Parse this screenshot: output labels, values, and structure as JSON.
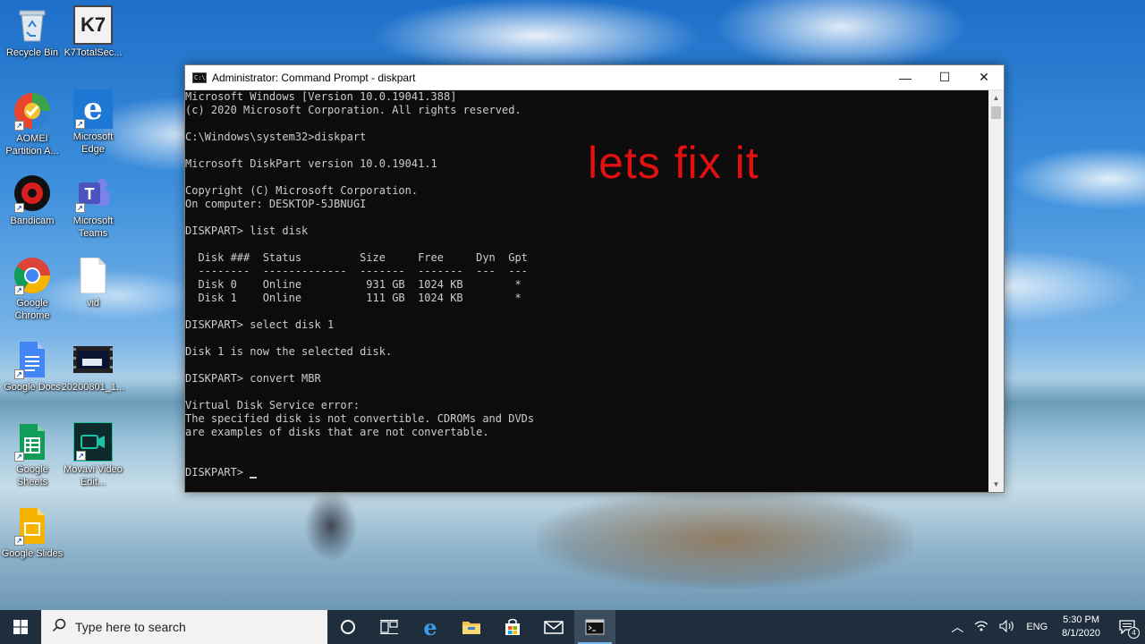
{
  "desktop": {
    "icons": [
      {
        "label": "Recycle Bin",
        "icon": "recycle-bin-icon"
      },
      {
        "label": "K7TotalSec...",
        "icon": "k7-icon",
        "glyph": "K7"
      },
      {
        "label": "AOMEI Partition A...",
        "icon": "aomei-icon"
      },
      {
        "label": "Microsoft Edge",
        "icon": "edge-icon"
      },
      {
        "label": "Bandicam",
        "icon": "bandicam-icon"
      },
      {
        "label": "Microsoft Teams",
        "icon": "teams-icon",
        "glyph": "T"
      },
      {
        "label": "Google Chrome",
        "icon": "chrome-icon"
      },
      {
        "label": "vid",
        "icon": "file-icon"
      },
      {
        "label": "Google Docs",
        "icon": "google-docs-icon"
      },
      {
        "label": "20200801_1...",
        "icon": "video-file-icon"
      },
      {
        "label": "Google Sheets",
        "icon": "google-sheets-icon"
      },
      {
        "label": "Movavi Video Edit...",
        "icon": "movavi-icon"
      },
      {
        "label": "Google Slides",
        "icon": "google-slides-icon"
      }
    ]
  },
  "window": {
    "title": "Administrator: Command Prompt - diskpart",
    "app_icon": "C:\\",
    "buttons": {
      "minimize": "—",
      "maximize": "☐",
      "close": "✕"
    },
    "console_lines": [
      "Microsoft Windows [Version 10.0.19041.388]",
      "(c) 2020 Microsoft Corporation. All rights reserved.",
      "",
      "C:\\Windows\\system32>diskpart",
      "",
      "Microsoft DiskPart version 10.0.19041.1",
      "",
      "Copyright (C) Microsoft Corporation.",
      "On computer: DESKTOP-5JBNUGI",
      "",
      "DISKPART> list disk",
      "",
      "  Disk ###  Status         Size     Free     Dyn  Gpt",
      "  --------  -------------  -------  -------  ---  ---",
      "  Disk 0    Online          931 GB  1024 KB        *",
      "  Disk 1    Online          111 GB  1024 KB        *",
      "",
      "DISKPART> select disk 1",
      "",
      "Disk 1 is now the selected disk.",
      "",
      "DISKPART> convert MBR",
      "",
      "Virtual Disk Service error:",
      "The specified disk is not convertible. CDROMs and DVDs",
      "are examples of disks that are not convertable.",
      "",
      ""
    ],
    "prompt": "DISKPART> ",
    "overlay_text": "lets fix it"
  },
  "taskbar": {
    "search_placeholder": "Type here to search",
    "pinned": [
      "cortana-icon",
      "task-view-icon",
      "edge-icon",
      "file-explorer-icon",
      "store-icon",
      "mail-icon",
      "cmd-icon"
    ],
    "tray": {
      "language": "ENG",
      "time": "5:30 PM",
      "date": "8/1/2020",
      "notification_count": "4"
    }
  },
  "colors": {
    "console_bg": "#0c0c0c",
    "console_fg": "#cccccc",
    "overlay_red": "#e31010",
    "taskbar_bg": "#1f2e3c"
  }
}
